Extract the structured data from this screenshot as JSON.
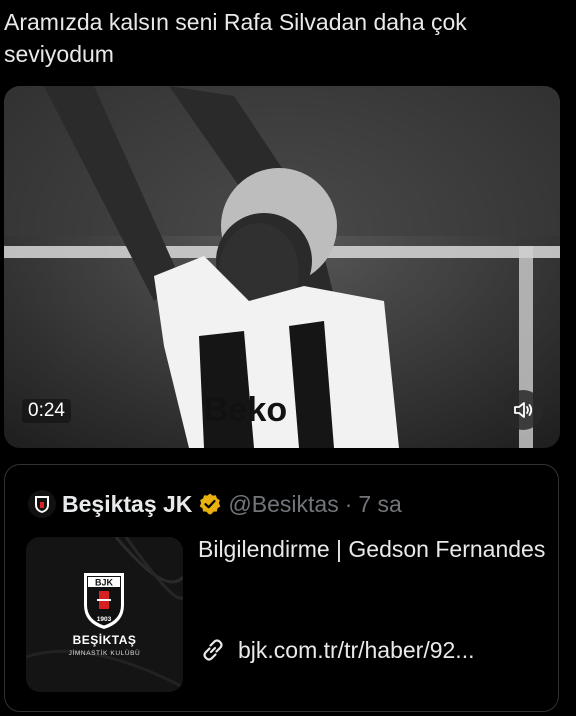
{
  "tweet": {
    "text": "Aramızda kalsın seni Rafa Silvadan daha çok seviyodum"
  },
  "media": {
    "duration": "0:24",
    "jersey_text": "Beko",
    "mute_icon": "speaker-icon"
  },
  "quote": {
    "name": "Beşiktaş JK",
    "handle": "@Besiktas",
    "separator": "·",
    "time": "7 sa",
    "title": "Bilgilendirme | Gedson Fernandes",
    "link_text": "bjk.com.tr/tr/haber/92...",
    "thumb": {
      "club_name": "BEŞİKTAŞ",
      "club_subtitle": "JİMNASTİK KULÜBÜ",
      "crest_letters": "BJK",
      "crest_year": "1903"
    },
    "verified_color": "#e8b10e"
  },
  "colors": {
    "background": "#000000",
    "text": "#e7e9ea",
    "muted": "#71767b",
    "border": "#2f3336"
  }
}
